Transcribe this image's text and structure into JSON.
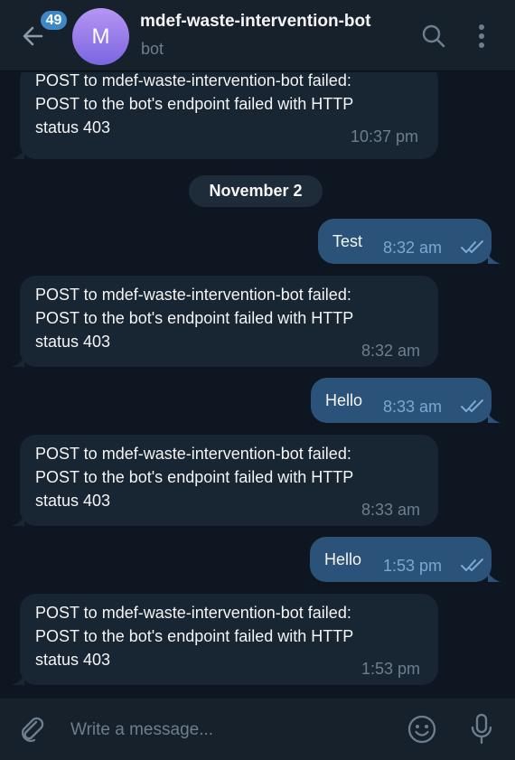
{
  "header": {
    "unread_count": "49",
    "avatar_letter": "M",
    "title": "mdef-waste-intervention-bot",
    "subtitle": "bot"
  },
  "messages": [
    {
      "direction": "in",
      "lines": [
        "POST to mdef-waste-intervention-bot failed:",
        "POST to the bot's endpoint failed with HTTP",
        "status 403"
      ],
      "time": "10:37 pm"
    },
    {
      "type": "date",
      "label": "November 2"
    },
    {
      "direction": "out",
      "text": "Test",
      "time": "8:32 am",
      "status": "read"
    },
    {
      "direction": "in",
      "lines": [
        "POST to mdef-waste-intervention-bot failed:",
        "POST to the bot's endpoint failed with HTTP",
        "status 403"
      ],
      "time": "8:32 am"
    },
    {
      "direction": "out",
      "text": "Hello",
      "time": "8:33 am",
      "status": "read"
    },
    {
      "direction": "in",
      "lines": [
        "POST to mdef-waste-intervention-bot failed:",
        "POST to the bot's endpoint failed with HTTP",
        "status 403"
      ],
      "time": "8:33 am"
    },
    {
      "direction": "out",
      "text": "Hello",
      "time": "1:53 pm",
      "status": "read"
    },
    {
      "direction": "in",
      "lines": [
        "POST to mdef-waste-intervention-bot failed:",
        "POST to the bot's endpoint failed with HTTP",
        "status 403"
      ],
      "time": "1:53 pm"
    }
  ],
  "composer": {
    "placeholder": "Write a message..."
  },
  "icons": [
    "back-arrow-icon",
    "search-icon",
    "more-vertical-icon",
    "double-check-icon",
    "paperclip-icon",
    "emoji-icon",
    "microphone-icon"
  ],
  "colors": {
    "background": "#0e1621",
    "header": "#17212b",
    "incoming_bubble": "#182533",
    "outgoing_bubble": "#2b5278",
    "accent": "#3e88c8"
  }
}
